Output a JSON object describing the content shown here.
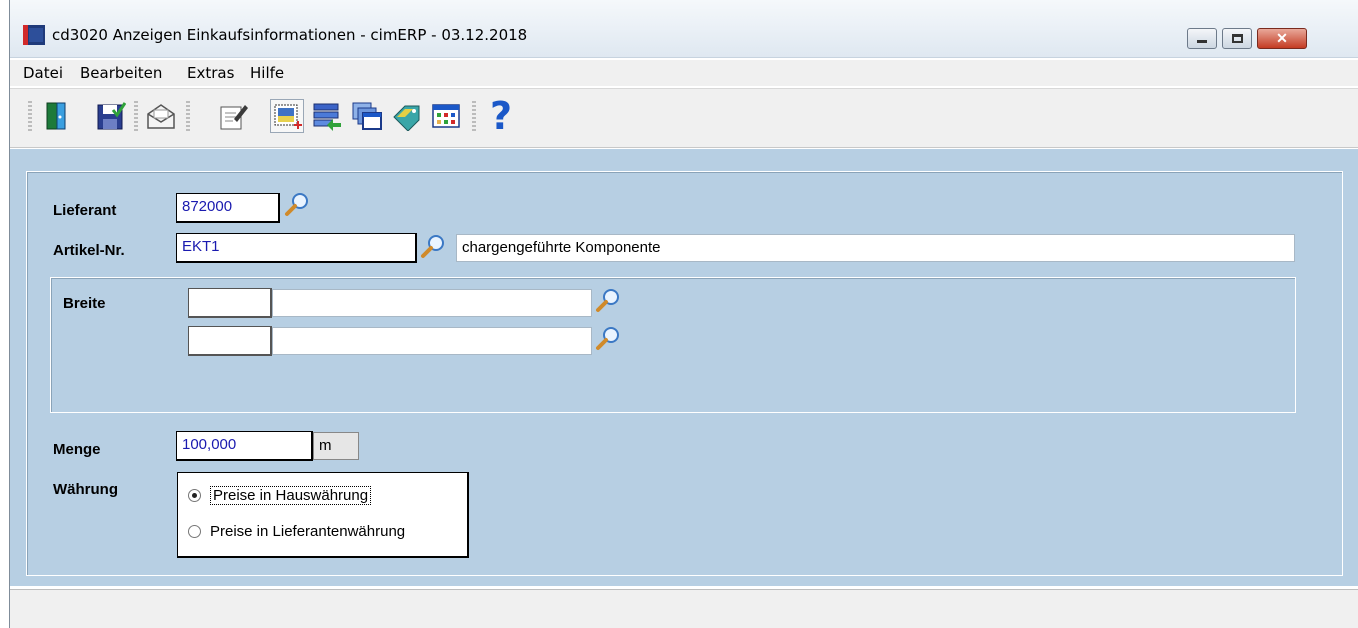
{
  "window": {
    "title": "cd3020 Anzeigen Einkaufsinformationen - cimERP - 03.12.2018",
    "close_glyph": "✕"
  },
  "menu": {
    "items": [
      "Datei",
      "Bearbeiten",
      "Extras",
      "Hilfe"
    ]
  },
  "toolbar": {
    "buttons": [
      {
        "icon": "exit-door-icon"
      },
      {
        "icon": "save-icon"
      },
      {
        "icon": "mail-icon"
      },
      {
        "icon": "edit-document-icon"
      },
      {
        "icon": "new-record-icon"
      },
      {
        "icon": "import-list-icon"
      },
      {
        "icon": "windows-icon"
      },
      {
        "icon": "label-tag-icon"
      },
      {
        "icon": "grid-table-icon"
      },
      {
        "icon": "help-icon"
      }
    ],
    "help_glyph": "?"
  },
  "form": {
    "lieferant_label": "Lieferant",
    "lieferant_value": "872000",
    "artikel_label": "Artikel-Nr.",
    "artikel_value": "EKT1",
    "artikel_description": "chargengeführte Komponente",
    "breite_label": "Breite",
    "breite_rows": [
      {
        "code": "",
        "text": ""
      },
      {
        "code": "",
        "text": ""
      }
    ],
    "menge_label": "Menge",
    "menge_value": "100,000",
    "menge_unit": "m",
    "waehrung_label": "Währung",
    "waehrung_options": [
      {
        "label": "Preise in Hauswährung",
        "checked": true
      },
      {
        "label": "Preise in Lieferantenwährung",
        "checked": false
      }
    ]
  },
  "colors": {
    "content_bg": "#b7cfe3",
    "value_text": "#1a1aaf"
  }
}
